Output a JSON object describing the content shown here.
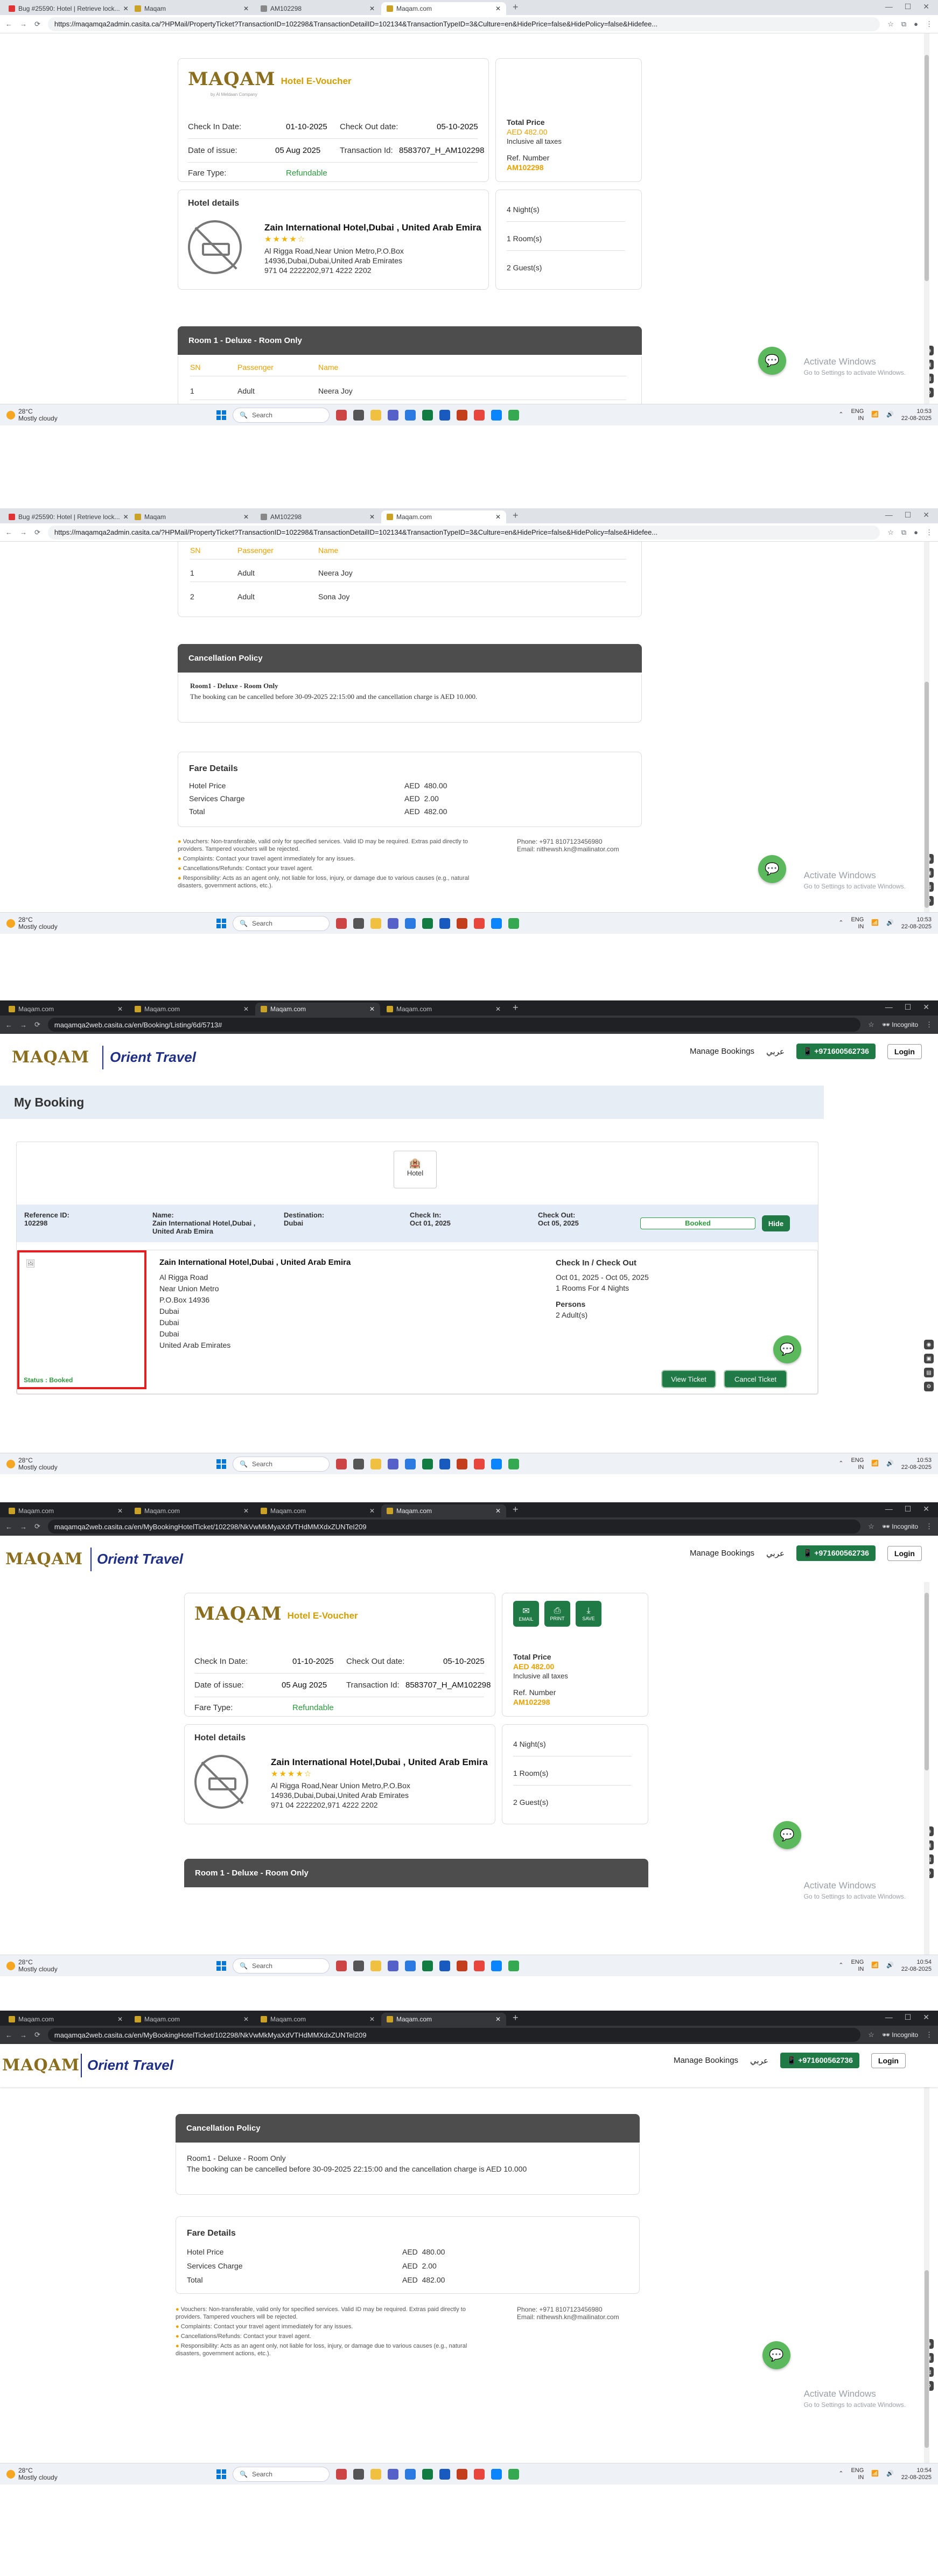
{
  "shot1": {
    "tabs": [
      "Bug #25590: Hotel | Retrieve lock...",
      "Maqam",
      "AM102298",
      "Maqam.com"
    ],
    "url": "https://maqamqa2admin.casita.ca/?HPMail/PropertyTicket?TransactionID=102298&TransactionDetailID=102134&TransactionTypeID=3&Culture=en&HidePrice=false&HidePolicy=false&Hidefee...",
    "voucher": {
      "logo_text": "MAQAM",
      "logo_tag": "by Al Meldaan Company",
      "title": "Hotel E-Voucher",
      "check_in_label": "Check In Date:",
      "check_in": "01-10-2025",
      "check_out_label": "Check Out date:",
      "check_out": "05-10-2025",
      "issue_label": "Date of issue:",
      "issue": "05 Aug 2025",
      "txn_label": "Transaction Id:",
      "txn": "8583707_H_AM102298",
      "fare_label": "Fare Type:",
      "fare": "Refundable",
      "total_label": "Total Price",
      "total": "AED 482.00",
      "taxes": "Inclusive all taxes",
      "ref_label": "Ref. Number",
      "ref": "AM102298"
    },
    "hotel": {
      "section": "Hotel details",
      "name": "Zain International Hotel,Dubai , United Arab Emira",
      "stars": "★★★★☆",
      "addr1": "Al Rigga Road,Near Union Metro,P.O.Box",
      "addr2": "14936,Dubai,Dubai,United Arab Emirates",
      "phone": "971 04 2222202,971 4222 2202",
      "nights": "4 Night(s)",
      "rooms": "1 Room(s)",
      "guests": "2 Guest(s)"
    },
    "room": {
      "title": "Room 1 - Deluxe - Room Only",
      "cols": [
        "SN",
        "Passenger",
        "Name"
      ],
      "rows": [
        [
          "1",
          "Adult",
          "Neera Joy"
        ],
        [
          "2",
          "Adult",
          "Sona Joy"
        ]
      ]
    }
  },
  "shot2": {
    "tabs": [
      "Bug #25590: Hotel | Retrieve lock...",
      "Maqam",
      "AM102298",
      "Maqam.com"
    ],
    "url": "https://maqamqa2admin.casita.ca/?HPMail/PropertyTicket?TransactionID=102298&TransactionDetailID=102134&TransactionTypeID=3&Culture=en&HidePrice=false&HidePolicy=false&Hidefee...",
    "cols": [
      "SN",
      "Passenger",
      "Name"
    ],
    "rows": [
      [
        "1",
        "Adult",
        "Neera Joy"
      ],
      [
        "2",
        "Adult",
        "Sona Joy"
      ]
    ],
    "cancel_title": "Cancellation Policy",
    "cancel_room": "Room1 - Deluxe - Room Only",
    "cancel_text": "The booking can be cancelled before 30-09-2025 22:15:00 and the cancellation charge is AED 10.000.",
    "fare_title": "Fare Details",
    "fare_rows": [
      [
        "Hotel Price",
        "AED",
        "480.00"
      ],
      [
        "Services Charge",
        "AED",
        "2.00"
      ],
      [
        "Total",
        "AED",
        "482.00"
      ]
    ],
    "notes": [
      "Vouchers: Non-transferable, valid only for specified services. Valid ID may be required. Extras paid directly to providers. Tampered vouchers will be rejected.",
      "Complaints: Contact your travel agent immediately for any issues.",
      "Cancellations/Refunds: Contact your travel agent.",
      "Responsibility: Acts as an agent only, not liable for loss, injury, or damage due to various causes (e.g., natural disasters, government actions, etc.)."
    ],
    "contact_phone": "Phone: +971 8107123456980",
    "contact_email": "Email: nithewsh.kn@mailinator.com"
  },
  "shot3": {
    "tabs": [
      "Maqam.com",
      "Maqam.com",
      "Maqam.com",
      "Maqam.com"
    ],
    "url": "maqamqa2web.casita.ca/en/Booking/Listing/6d/5713#",
    "nav": {
      "manage": "Manage Bookings",
      "lang": "عربي",
      "phone": "+971600562736",
      "login": "Login",
      "brand": "Orient Travel"
    },
    "page_title": "My Booking",
    "tab_label": "Hotel",
    "ref_label": "Reference ID:",
    "ref": "102298",
    "name_label": "Name:",
    "name": "Zain International Hotel,Dubai , United Arab Emira",
    "dest_label": "Destination:",
    "dest": "Dubai",
    "checkin_label": "Check In:",
    "checkin": "Oct 01, 2025",
    "checkout_label": "Check Out:",
    "checkout": "Oct 05, 2025",
    "booked": "Booked",
    "hide": "Hide",
    "hotel_name": "Zain International Hotel,Dubai , United Arab Emira",
    "addr_lines": [
      "Al Rigga Road",
      "Near Union Metro",
      "P.O.Box 14936",
      "Dubai",
      "Dubai",
      "Dubai",
      "United Arab Emirates"
    ],
    "cio_label": "Check In / Check Out",
    "cio": "Oct 01, 2025 - Oct 05, 2025",
    "rooms_nights": "1 Rooms For 4 Nights",
    "persons_label": "Persons",
    "persons": "2 Adult(s)",
    "status": "Status : Booked",
    "view_ticket": "View Ticket",
    "cancel_ticket": "Cancel Ticket"
  },
  "shot4": {
    "tabs": [
      "Maqam.com",
      "Maqam.com",
      "Maqam.com",
      "Maqam.com"
    ],
    "url": "maqamqa2web.casita.ca/en/MyBookingHotelTicket/102298/NkVwMkMyaXdVTHdMMXdxZUNTeI209",
    "buttons": [
      "EMAIL",
      "PRINT",
      "SAVE"
    ]
  },
  "shot5": {
    "tabs": [
      "Maqam.com",
      "Maqam.com",
      "Maqam.com",
      "Maqam.com"
    ],
    "url": "maqamqa2web.casita.ca/en/MyBookingHotelTicket/102298/NkVwMkMyaXdVTHdMMXdxZUNTeI209",
    "cancel_text": "The booking can be cancelled before 30-09-2025 22:15:00 and the cancellation charge is AED 10.000"
  },
  "taskbar": {
    "temp": "28°C",
    "weather": "Mostly cloudy",
    "search": "Search",
    "lang": "ENG",
    "region": "IN",
    "times": [
      "10:53",
      "10:53",
      "10:53",
      "10:54",
      "10:54"
    ],
    "date": "22-08-2025"
  },
  "activate": {
    "title": "Activate Windows",
    "sub": "Go to Settings to activate Windows."
  }
}
